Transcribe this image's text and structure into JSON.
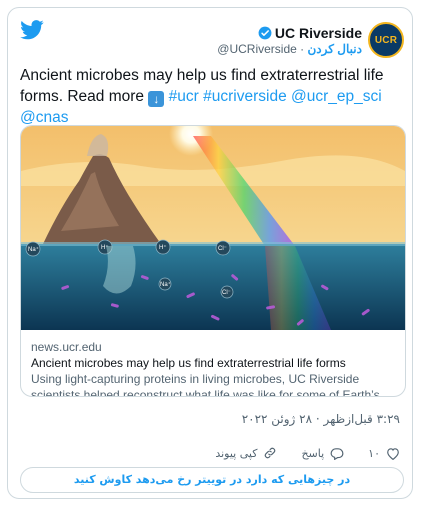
{
  "author": {
    "name": "UC Riverside",
    "follow_label": "دنبال کردن",
    "handle": "@UCRiverside",
    "avatar_text": "UCR"
  },
  "tweet": {
    "text_plain": "Ancient microbes may help us find extraterrestrial life forms. Read more",
    "emoji": "⬇️",
    "tags": [
      "#ucr",
      "#ucriverside",
      "@ucr_ep_sci",
      "@cnas"
    ]
  },
  "link_card": {
    "domain": "news.ucr.edu",
    "title": "Ancient microbes may help us find extraterrestrial life forms",
    "description": "Using light-capturing proteins in living microbes, UC Riverside scientists helped reconstruct what life was like for some of Earth’s earliest ..."
  },
  "image_labels": [
    "Na⁺",
    "H⁺",
    "H⁺",
    "Cl⁻",
    "Cl⁻",
    "Na⁺"
  ],
  "datetime": "۳:۲۹ قبل‌ازظهر · ۲۸ ژوئن ۲۰۲۲",
  "actions": {
    "likes_count": "۱۰",
    "reply_label": "پاسخ",
    "copy_link_label": "کپی پیوند"
  },
  "explore_label": "در چیزهایی که دارد در توییتر رخ می‌دهد کاوش کنید",
  "colors": {
    "accent": "#1d9bf0",
    "secondary_text": "#536471",
    "border": "#cfd9de"
  }
}
